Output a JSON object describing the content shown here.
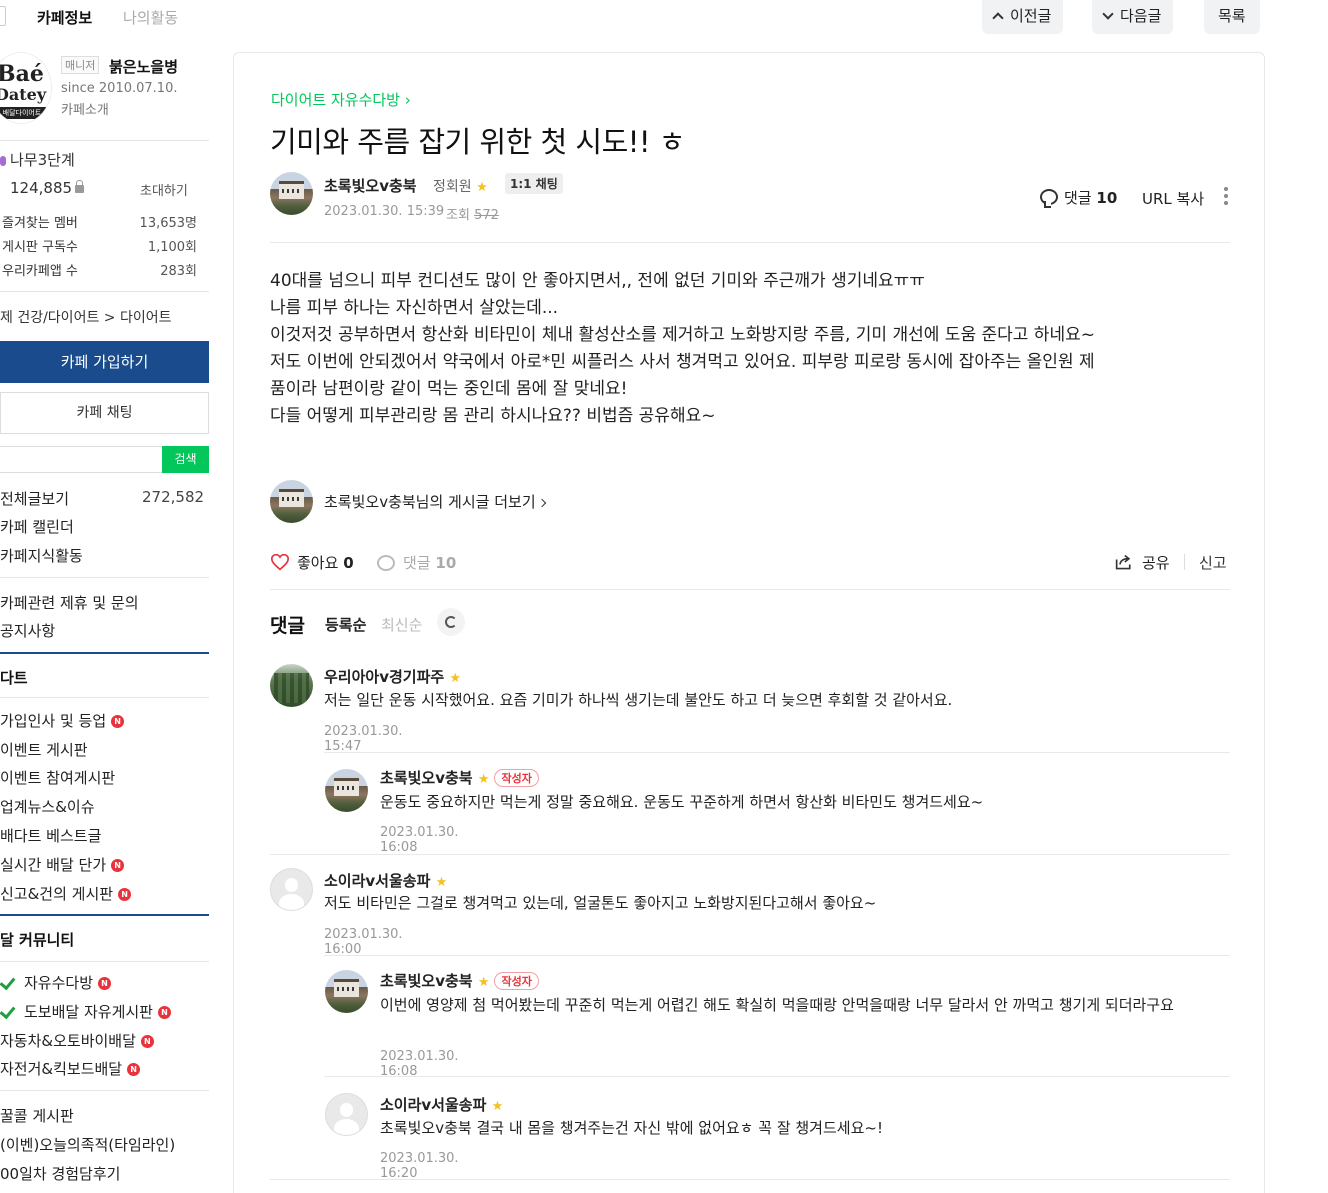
{
  "sidebar": {
    "tabs": [
      "카페정보",
      "나의활동"
    ],
    "logo": {
      "line1": "Baé",
      "line2": "Datey",
      "line3": "배달다이어트"
    },
    "manager_label": "매니저",
    "manager_name": "붉은노을병",
    "since": "since 2010.07.10.",
    "intro": "카페소개",
    "grade": "나무3단계",
    "member_count": "124,885",
    "invite": "초대하기",
    "stats": [
      {
        "label": "즐겨찾는 멤버",
        "value": "13,653명"
      },
      {
        "label": "게시판 구독수",
        "value": "1,100회"
      },
      {
        "label": "우리카페앱 수",
        "value": "283회"
      }
    ],
    "category": "제  건강/다이어트 > 다이어트",
    "join_button": "카페 가입하기",
    "chat_button": "카페 채팅",
    "search_button": "검색",
    "menu_group1": [
      {
        "label": "전체글보기",
        "count": "272,582"
      },
      {
        "label": "카페 캘린더"
      },
      {
        "label": "카페지식활동"
      }
    ],
    "menu_group2": [
      {
        "label": "카페관련 제휴 및 문의"
      },
      {
        "label": "공지사항"
      }
    ],
    "section1_title": "다트",
    "section1_items": [
      {
        "label": "가입인사 및 등업",
        "new": true
      },
      {
        "label": "이벤트 게시판",
        "new": false
      },
      {
        "label": "이벤트 참여게시판",
        "new": false
      },
      {
        "label": "업계뉴스&이슈",
        "new": false
      },
      {
        "label": "배다트 베스트글",
        "new": false
      },
      {
        "label": "실시간 배달 단가",
        "new": true
      },
      {
        "label": "신고&건의 게시판",
        "new": true
      }
    ],
    "section2_title": "달 커뮤니티",
    "section2_items": [
      {
        "label": "자유수다방",
        "new": true,
        "check": true
      },
      {
        "label": "도보배달 자유게시판",
        "new": true,
        "check": true
      },
      {
        "label": "자동차&오토바이배달",
        "new": true,
        "check": false
      },
      {
        "label": "자전거&킥보드배달",
        "new": true,
        "check": false
      }
    ],
    "section3_items": [
      {
        "label": "꿀콜 게시판"
      },
      {
        "label": "(이벤)오늘의족적(타임라인)"
      },
      {
        "label": "00일차 경험담후기"
      }
    ],
    "new_badge": "N"
  },
  "topnav": {
    "prev": "이전글",
    "next": "다음글",
    "list": "목록"
  },
  "article": {
    "board": "다이어트 자유수다방",
    "title": "기미와 주름 잡기 위한 첫 시도!! ㅎ",
    "author": "초록빛오v충북",
    "rank": "정회원",
    "chat_badge": "1:1 채팅",
    "date": "2023.01.30. 15:39",
    "views_label": "조회",
    "views": "572",
    "comment_label": "댓글",
    "comment_count": "10",
    "url_copy": "URL 복사",
    "body": "40대를 넘으니 피부 컨디션도 많이 안 좋아지면서,, 전에 없던 기미와 주근깨가 생기네요ㅠㅠ\n나름 피부 하나는 자신하면서 살았는데...\n이것저것 공부하면서 항산화 비타민이 체내 활성산소를 제거하고 노화방지랑 주름, 기미 개선에 도움 준다고 하네요~\n저도 이번에 안되겠어서 약국에서 아로*민 씨플러스 사서 챙겨먹고 있어요. 피부랑 피로랑 동시에 잡아주는 올인원 제\n품이라 남편이랑 같이 먹는 중인데 몸에 잘 맞네요!\n다들 어떻게 피부관리랑 몸 관리 하시나요?? 비법즘 공유해요~",
    "more_posts": "초록빛오v충북님의 게시글 더보기",
    "like_label": "좋아요",
    "like_count": "0",
    "share": "공유",
    "report": "신고"
  },
  "comments_section": {
    "title": "댓글",
    "sort_registered": "등록순",
    "sort_latest": "최신순",
    "writer_badge": "작성자"
  },
  "comments": [
    {
      "nick": "우리아아v경기파주",
      "text": "저는 일단 운동 시작했어요. 요즘 기미가 하나씩 생기는데 불안도 하고 더 늦으면 후회할 것 같아서요.",
      "time": "2023.01.30. 15:47",
      "avatar": "forest",
      "reply": false,
      "writer": false
    },
    {
      "nick": "초록빛오v충북",
      "text": "운동도 중요하지만 먹는게 정말 중요해요. 운동도 꾸준하게 하면서 항산화 비타민도 챙겨드세요~",
      "time": "2023.01.30. 16:08",
      "avatar": "building",
      "reply": true,
      "writer": true
    },
    {
      "nick": "소이라v서울송파",
      "text": "저도 비타민은 그걸로 챙겨먹고 있는데, 얼굴톤도 좋아지고 노화방지된다고해서 좋아요~",
      "time": "2023.01.30. 16:00",
      "avatar": "default",
      "reply": false,
      "writer": false
    },
    {
      "nick": "초록빛오v충북",
      "text": "이번에 영양제 첨 먹어봤는데 꾸준히 먹는게 어렵긴 해도 확실히 먹을때랑 안먹을때랑 너무 달라서 안 까먹고 챙기게 되더라구요",
      "time": "2023.01.30. 16:08",
      "avatar": "building",
      "reply": true,
      "writer": true
    },
    {
      "nick": "소이라v서울송파",
      "mention": "초록빛오v충북",
      "text": "결국 내 몸을 챙겨주는건 자신 밖에 없어요ㅎ 꼭 잘 챙겨드세요~!",
      "time": "2023.01.30. 16:20",
      "avatar": "default",
      "reply": true,
      "writer": false
    }
  ]
}
